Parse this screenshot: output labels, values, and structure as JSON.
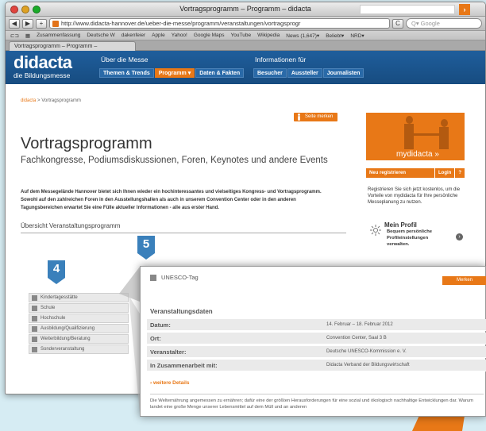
{
  "browser": {
    "window_title": "Vortragsprogramm – Programm – didacta",
    "back_label": "◀",
    "forward_label": "▶",
    "add_label": "+",
    "url": "http://www.didacta-hannover.de/ueber-die-messe/programm/veranstaltungen/vortragsprogr",
    "reload_label": "C",
    "search_placeholder": "Q▾ Google",
    "bookmarks": [
      "Zusammenfassung",
      "Deutsche W",
      "dakenfeier",
      "Apple",
      "Yahoo!",
      "Google Maps",
      "YouTube",
      "Wikipedia",
      "News (1,647)▾",
      "Beliebt▾",
      "NRD▾"
    ],
    "tab_label": "Vortragsprogramm – Programm –"
  },
  "site": {
    "logo_main": "didacta",
    "logo_sub": "die Bildungsmesse",
    "nav_group1_title": "Über die Messe",
    "nav_group2_title": "Informationen für",
    "nav_group1": [
      "Themen & Trends",
      "Programm ▾",
      "Daten & Fakten"
    ],
    "nav_group2": [
      "Besucher",
      "Aussteller",
      "Journalisten"
    ],
    "search_go": "›"
  },
  "breadcrumb": {
    "home": "didacta",
    "sep": " > ",
    "current": "Vortragsprogramm"
  },
  "page": {
    "merken_label": "Seite merken",
    "title": "Vortragsprogramm",
    "subtitle": "Fachkongresse, Podiumsdiskussionen, Foren, Keynotes und andere Events",
    "intro": "Auf dem Messegelände Hannover bietet sich Ihnen wieder ein hochinteressantes und vielseitiges Kongress- und Vortragsprogramm. Sowohl auf den zahlreichen Foren in den Ausstellungshallen als auch in unserem Convention Center oder in den anderen Tagungsbereichen erwartet Sie eine Fülle aktueller Informationen - alle aus erster Hand.",
    "overview": "Übersicht Veranstaltungsprogramm"
  },
  "sidebar": {
    "mydidacta": "mydidacta »",
    "neu_registrieren": "Neu registrieren",
    "login": "Login",
    "help": "?",
    "register_text": "Registrieren Sie sich jetzt kostenlos, um die Vorteile von mydidacta für Ihre persönliche Messeplanung zu nutzen.",
    "profil_title": "Mein Profil",
    "profil_text": "Bequem persönliche Profileinstellungen verwalten.",
    "profil_arrow": "›"
  },
  "categories": [
    "Kindertagesstätte",
    "Schule",
    "Hochschule",
    "Ausbildung/Qualifizierung",
    "Weiterbildung/Beratung",
    "Sonderveranstaltung"
  ],
  "badges": {
    "four": "4",
    "five": "5"
  },
  "popup": {
    "heading": "UNESCO-Tag",
    "merken": "Merken",
    "section_title": "Veranstaltungsdaten",
    "rows": [
      {
        "key": "Datum:",
        "value": "14. Februar – 18. Februar 2012"
      },
      {
        "key": "Ort:",
        "value": "Convention Center, Saal 3 B"
      },
      {
        "key": "Veranstalter:",
        "value": "Deutsche UNESCO-Kommission e. V."
      },
      {
        "key": "In Zusammenarbeit mit:",
        "value": "Didacta Verband der Bildungswirtschaft"
      }
    ],
    "more": "› weitere Details",
    "text": "Die Welternährung angemessen zu ernähren; dafür eine der größten Herausforderungen für eine sozial und ökologisch nachhaltige Entwicklungen dar. Warum landet eine große Menge unserer Lebensmittel auf dem Müll und an anderen"
  },
  "colors": {
    "accent": "#e87817",
    "brand_blue": "#1f5e9c",
    "badge_blue": "#3a80bb"
  }
}
